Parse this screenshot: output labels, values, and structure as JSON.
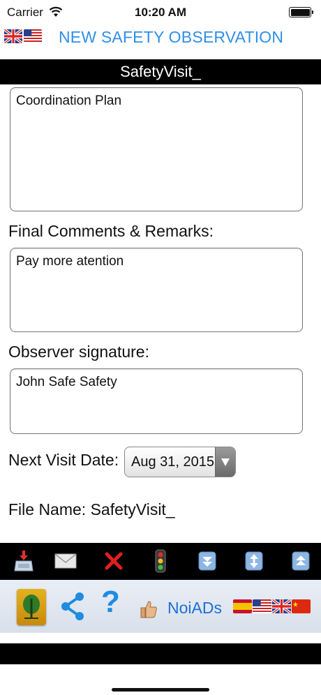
{
  "status": {
    "carrier": "Carrier",
    "time": "10:20 AM"
  },
  "nav": {
    "title": "NEW SAFETY OBSERVATION",
    "flags": [
      "uk-flag-icon",
      "us-flag-icon"
    ]
  },
  "section": {
    "title": "SafetyVisit_"
  },
  "form": {
    "coordination_value": "Coordination Plan",
    "final_comments_label": "Final Comments & Remarks:",
    "final_comments_value": "Pay more atention",
    "observer_label": "Observer signature:",
    "observer_value": "John Safe Safety",
    "next_visit_label": "Next Visit Date:",
    "next_visit_value": "Aug 31, 2015",
    "file_name_label": "File Name: SafetyVisit_"
  },
  "toolbar": {
    "icons": [
      "save-icon",
      "mail-icon",
      "delete-icon",
      "traffic-light-icon",
      "scroll-down-icon",
      "scroll-updown-icon",
      "scroll-up-icon"
    ]
  },
  "ads_bar": {
    "noiads_label": "NoiADs",
    "flags": [
      "spain-flag-icon",
      "us-flag-icon",
      "uk-flag-icon",
      "china-flag-icon"
    ]
  },
  "colors": {
    "accent": "#2f8fe8",
    "link": "#1d6fd6",
    "delete": "#e02020",
    "bar": "#000000"
  }
}
